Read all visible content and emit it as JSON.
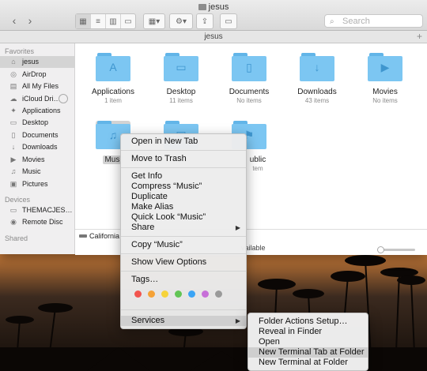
{
  "window": {
    "title": "jesus",
    "path_title": "jesus"
  },
  "toolbar": {
    "back_glyph": "‹",
    "forward_glyph": "›",
    "view_icons": [
      "▦",
      "≡",
      "▥",
      "▭"
    ],
    "arrange_glyph": "▦▾",
    "action_glyph": "⚙▾",
    "share_glyph": "⇪",
    "tag_glyph": "▭",
    "search_placeholder": "Search",
    "search_icon": "⌕",
    "add_tab_glyph": "+"
  },
  "sidebar": {
    "sections": [
      {
        "title": "Favorites",
        "items": [
          {
            "label": "jesus",
            "icon": "⌂",
            "selected": true
          },
          {
            "label": "AirDrop",
            "icon": "◎"
          },
          {
            "label": "All My Files",
            "icon": "▤"
          },
          {
            "label": "iCloud Dri…",
            "icon": "☁"
          },
          {
            "label": "Applications",
            "icon": "✦"
          },
          {
            "label": "Desktop",
            "icon": "▭"
          },
          {
            "label": "Documents",
            "icon": "▯"
          },
          {
            "label": "Downloads",
            "icon": "↓"
          },
          {
            "label": "Movies",
            "icon": "▶"
          },
          {
            "label": "Music",
            "icon": "♫"
          },
          {
            "label": "Pictures",
            "icon": "▣"
          }
        ]
      },
      {
        "title": "Devices",
        "items": [
          {
            "label": "THEMACJES…",
            "icon": "▭"
          },
          {
            "label": "Remote Disc",
            "icon": "◉"
          }
        ]
      },
      {
        "title": "Shared",
        "items": []
      }
    ]
  },
  "folders": [
    {
      "name": "Applications",
      "count": "1 item",
      "glyph": "A"
    },
    {
      "name": "Desktop",
      "count": "11 items",
      "glyph": "▭"
    },
    {
      "name": "Documents",
      "count": "No items",
      "glyph": "▯"
    },
    {
      "name": "Downloads",
      "count": "43 items",
      "glyph": "↓"
    },
    {
      "name": "Movies",
      "count": "No items",
      "glyph": "▶"
    },
    {
      "name": "Music",
      "count": "",
      "glyph": "♫",
      "selected": true,
      "label_visible": "Musi"
    },
    {
      "name": "",
      "count": "",
      "glyph": "▣"
    },
    {
      "name": "ublic",
      "count": "tem",
      "glyph": "⚑"
    }
  ],
  "status": {
    "disk_label": "California",
    "available_text": "vailable"
  },
  "context_menu": {
    "items": [
      {
        "label": "Open in New Tab"
      },
      {
        "label": "Move to Trash"
      },
      {
        "label": "Get Info"
      },
      {
        "label": "Compress “Music”"
      },
      {
        "label": "Duplicate"
      },
      {
        "label": "Make Alias"
      },
      {
        "label": "Quick Look “Music”"
      },
      {
        "label": "Share",
        "submenu": true
      },
      {
        "label": "Copy “Music”"
      },
      {
        "label": "Show View Options"
      },
      {
        "label": "Tags…"
      },
      {
        "label": "Services",
        "submenu": true,
        "highlighted": true
      }
    ],
    "tag_colors": [
      "#f2544e",
      "#f5a237",
      "#f6d33a",
      "#62c555",
      "#3ba4f5",
      "#c76fd8",
      "#9a9a9a"
    ],
    "submenu_arrow": "▶"
  },
  "services_submenu": {
    "items": [
      {
        "label": "Folder Actions Setup…"
      },
      {
        "label": "Reveal in Finder"
      },
      {
        "label": "Open"
      },
      {
        "label": "New Terminal Tab at Folder",
        "highlighted": true
      },
      {
        "label": "New Terminal at Folder"
      }
    ]
  }
}
